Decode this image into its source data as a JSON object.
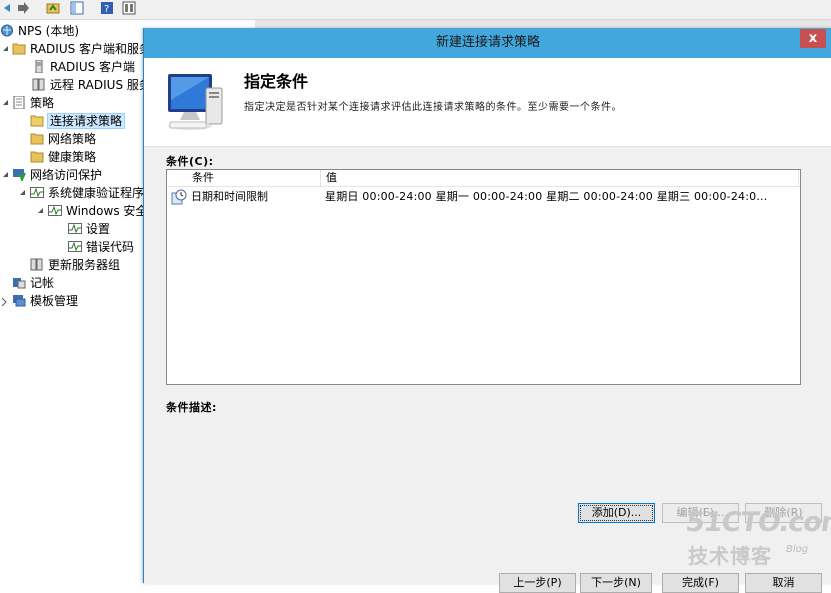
{
  "tree": {
    "items": [
      {
        "label": "NPS (本地)"
      },
      {
        "label": "RADIUS 客户端和服务"
      },
      {
        "label": "RADIUS 客户端"
      },
      {
        "label": "远程 RADIUS 服务"
      },
      {
        "label": "策略"
      },
      {
        "label": "连接请求策略"
      },
      {
        "label": "网络策略"
      },
      {
        "label": "健康策略"
      },
      {
        "label": "网络访问保护"
      },
      {
        "label": "系统健康验证程序"
      },
      {
        "label": "Windows 安全"
      },
      {
        "label": "设置"
      },
      {
        "label": "错误代码"
      },
      {
        "label": "更新服务器组"
      },
      {
        "label": "记帐"
      },
      {
        "label": "模板管理"
      }
    ]
  },
  "dialog": {
    "title": "新建连接请求策略",
    "close_label": "x",
    "step_title": "指定条件",
    "step_desc": "指定决定是否针对某个连接请求评估此连接请求策略的条件。至少需要一个条件。",
    "conditions_label": "条件(C):",
    "columns": {
      "cond": "条件",
      "value": "值"
    },
    "row": {
      "cond": "日期和时间限制",
      "value": "星期日 00:00-24:00 星期一 00:00-24:00 星期二 00:00-24:00 星期三 00:00-24:0..."
    },
    "desc_label": "条件描述:",
    "buttons": {
      "add": "添加(D)...",
      "edit": "编辑(E)...",
      "remove": "删除(R)",
      "prev": "上一步(P)",
      "next": "下一步(N)",
      "finish": "完成(F)",
      "cancel": "取消"
    }
  },
  "watermark": {
    "site": "51CTO.com",
    "tagline": "技术博客",
    "suffix": "Blog"
  },
  "colors": {
    "titlebar": "#41a7dc",
    "close": "#c75050",
    "selection": "#cde8ff"
  }
}
